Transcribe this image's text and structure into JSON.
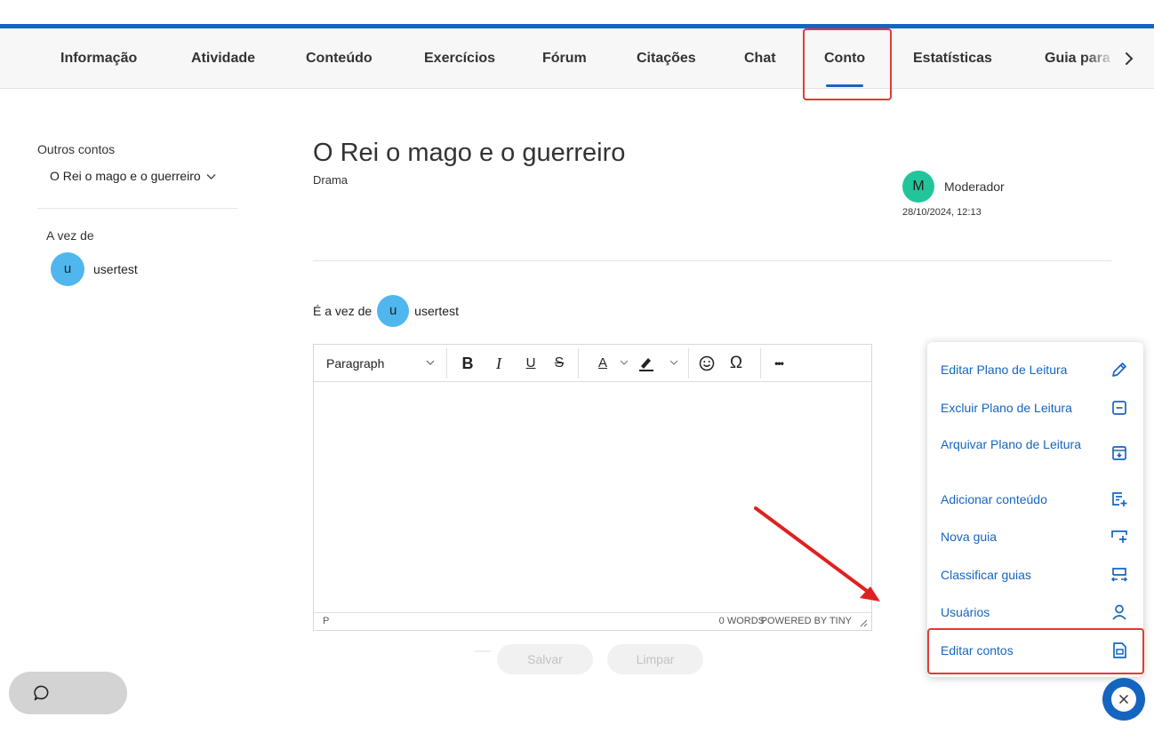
{
  "nav": {
    "tabs": [
      "Informação",
      "Atividade",
      "Conteúdo",
      "Exercícios",
      "Fórum",
      "Citações",
      "Chat",
      "Conto",
      "Estatísticas"
    ],
    "active_tab": "Conto",
    "overflow_tab": "Guia para",
    "next_icon": "chevron-right-icon"
  },
  "sidebar": {
    "other_stories_label": "Outros contos",
    "selected_story": "O Rei o mago e o guerreiro",
    "turn_label": "A vez de",
    "turn_user": {
      "initial": "u",
      "name": "usertest"
    }
  },
  "story": {
    "title": "O Rei o mago e o guerreiro",
    "genre": "Drama",
    "author": {
      "initial": "M",
      "name": "Moderador",
      "date": "28/10/2024, 12:13"
    }
  },
  "turn": {
    "label": "É a vez de",
    "user": {
      "initial": "u",
      "name": "usertest"
    }
  },
  "editor": {
    "block_format": "Paragraph",
    "toolbar": {
      "bold": "B",
      "italic": "I",
      "underline": "U",
      "strikethrough": "S",
      "font_color": "A",
      "special_char": "Ω",
      "more": "•••"
    },
    "status_path": "P",
    "word_count": "0 WORDS",
    "powered_by": "POWERED BY TINY"
  },
  "actions": {
    "save": "Salvar",
    "clear": "Limpar"
  },
  "menu": {
    "items": [
      {
        "label": "Editar Plano de Leitura",
        "icon": "pencil-icon"
      },
      {
        "label": "Excluir Plano de Leitura",
        "icon": "minus-box-icon"
      },
      {
        "label": "Arquivar Plano de Leitura",
        "icon": "archive-icon"
      },
      {
        "label": "Adicionar conteúdo",
        "icon": "add-content-icon"
      },
      {
        "label": "Nova guia",
        "icon": "new-tab-icon"
      },
      {
        "label": "Classificar guias",
        "icon": "sort-tabs-icon"
      },
      {
        "label": "Usuários",
        "icon": "user-icon"
      },
      {
        "label": "Editar contos",
        "icon": "edit-story-icon"
      }
    ]
  },
  "colors": {
    "accent": "#1565c0",
    "highlight": "#e53935",
    "avatar_user": "#4fb6ee",
    "avatar_moderator": "#22c59a"
  }
}
